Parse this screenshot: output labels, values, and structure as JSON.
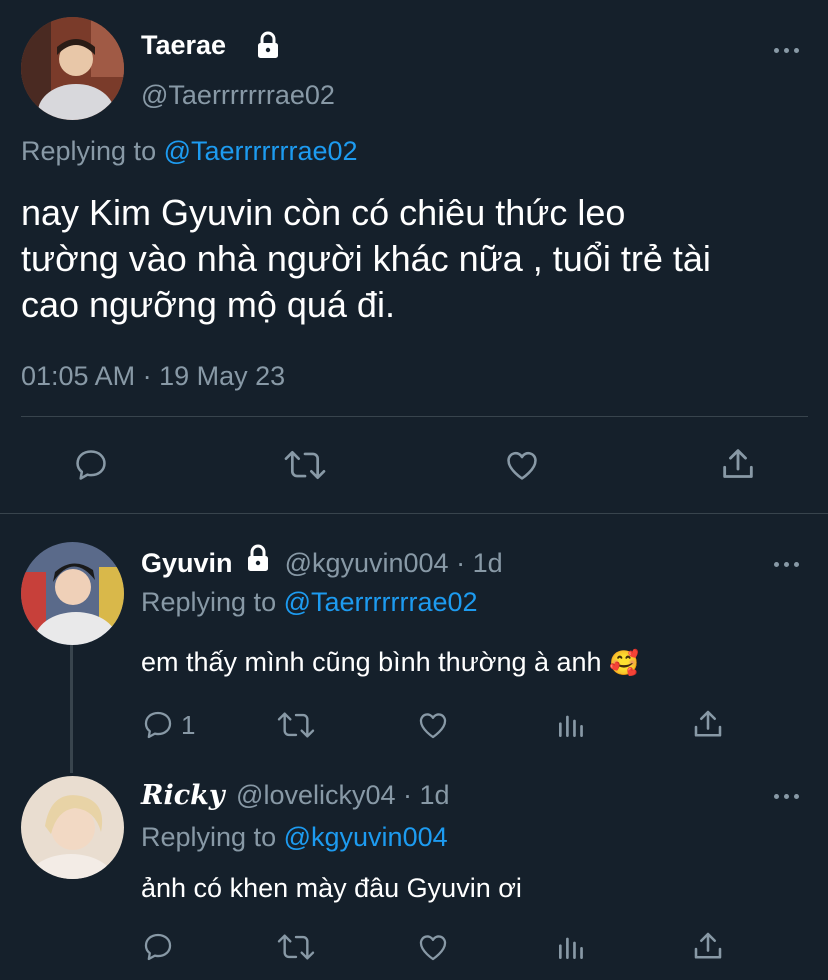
{
  "main_tweet": {
    "display_name": "Taerae",
    "handle": "@Taerrrrrrrae02",
    "replying_prefix": "Replying to",
    "replying_to": "@Taerrrrrrrae02",
    "text_lines": [
      "nay Kim Gyuvin còn có chiêu thức leo",
      "tường vào nhà người khác nữa , tuổi trẻ tài",
      "cao ngưỡng mộ quá đi."
    ],
    "timestamp": "01:05 AM · 19 May 23"
  },
  "replies": [
    {
      "display_name": "Gyuvin",
      "handle": "@kgyuvin004",
      "time": "· 1d",
      "replying_prefix": "Replying to",
      "replying_to": "@Taerrrrrrrae02",
      "text": "em thấy mình cũng bình thường à anh",
      "emoji": "🥰",
      "reply_count": "1"
    },
    {
      "display_name": "𝑹𝒊𝒄𝒌𝒚",
      "handle": "@lovelicky04",
      "time": "· 1d",
      "replying_prefix": "Replying to",
      "replying_to": "@kgyuvin004",
      "text": "ảnh có khen mày đâu Gyuvin ơi",
      "reply_count": ""
    }
  ],
  "colors": {
    "background": "#15202b",
    "muted": "#8899a6",
    "link": "#1d9bf0",
    "divider": "#38444d"
  },
  "icons": [
    "lock-icon",
    "more-icon",
    "reply-icon",
    "retweet-icon",
    "like-icon",
    "share-icon",
    "views-icon"
  ]
}
